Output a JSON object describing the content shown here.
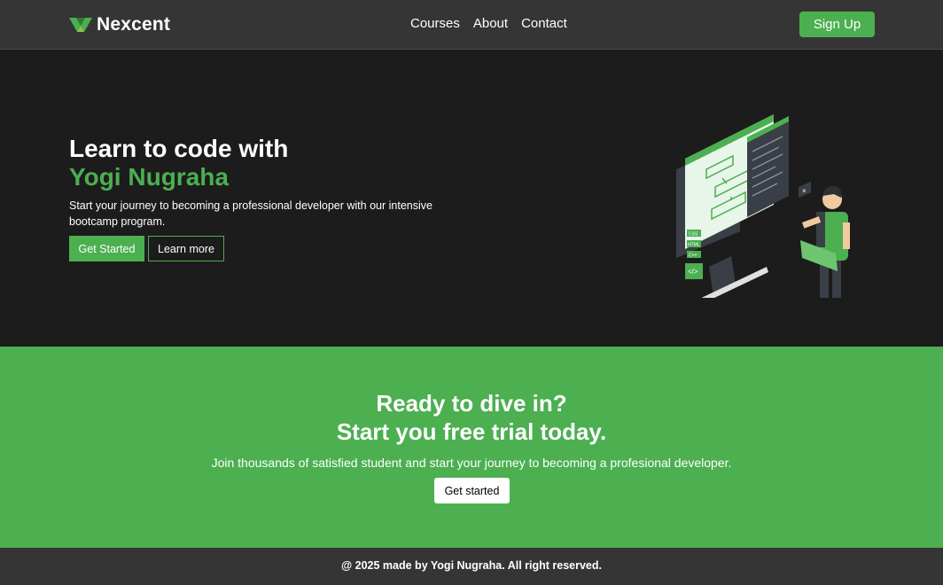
{
  "colors": {
    "accent": "#4caf50",
    "navbar": "#353535",
    "hero_bg": "#1c1c1c"
  },
  "navbar": {
    "brand": "Nexcent",
    "logo_icon": "nexcent-logo-icon",
    "links": [
      "Courses",
      "About",
      "Contact"
    ],
    "signup_label": "Sign Up"
  },
  "hero": {
    "title_line1": "Learn to code with",
    "title_line2": "Yogi Nugraha",
    "description": "Start your journey to becoming a professional developer with our intensive bootcamp program.",
    "primary_button": "Get Started",
    "secondary_button": "Learn more",
    "illustration": "developer-coding-illustration",
    "illustration_labels": [
      "CSS",
      "HTML",
      "C++",
      "</>"
    ]
  },
  "cta": {
    "title_line1": "Ready to dive in?",
    "title_line2": "Start you free trial today.",
    "description": "Join thousands of satisfied student and start your journey to becoming a profesional developer.",
    "button": "Get started"
  },
  "footer": {
    "text": "@ 2025 made by Yogi Nugraha. All right reserved."
  }
}
